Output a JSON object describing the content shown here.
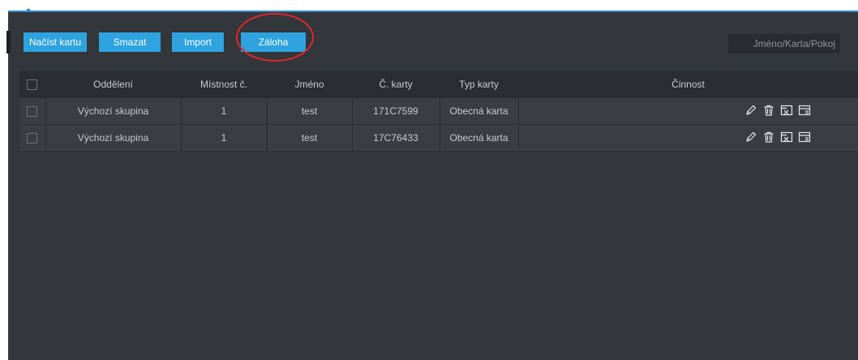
{
  "toolbar": {
    "read_card_label": "Načíst kartu",
    "delete_label": "Smazat",
    "import_label": "Import",
    "backup_label": "Záloha",
    "search_placeholder": "Jméno/Karta/Pokoj"
  },
  "table": {
    "columns": [
      "Oddělení",
      "Místnost č.",
      "Jméno",
      "Č. karty",
      "Typ karty",
      "Činnost"
    ],
    "rows": [
      {
        "department": "Výchozí skupina",
        "room": "1",
        "name": "test",
        "card_no": "171C7599",
        "card_type": "Obecná karta"
      },
      {
        "department": "Výchozí skupina",
        "room": "1",
        "name": "test",
        "card_no": "17C76433",
        "card_type": "Obecná karta"
      }
    ]
  },
  "icons": {
    "edit": "pencil-icon",
    "delete": "trash-icon",
    "deactivate": "card-cancel-icon",
    "card": "card-icon"
  },
  "colors": {
    "accent": "#2ea3df",
    "panel": "#33363b",
    "annotation": "#e0262b"
  }
}
